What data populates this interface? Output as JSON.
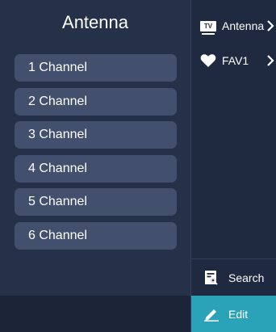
{
  "left_panel": {
    "title": "Antenna",
    "channels": [
      {
        "label": "1 Channel"
      },
      {
        "label": "2 Channel"
      },
      {
        "label": "3 Channel"
      },
      {
        "label": "4 Channel"
      },
      {
        "label": "5 Channel"
      },
      {
        "label": "6 Channel"
      }
    ]
  },
  "right_panel": {
    "nav": [
      {
        "label": "Antenna",
        "icon": "tv-icon"
      },
      {
        "label": "FAV1",
        "icon": "heart-icon"
      }
    ],
    "search_label": "Search",
    "edit_label": "Edit"
  },
  "colors": {
    "background": "#1f2a40",
    "channel_item": "#42506d",
    "edit_accent": "#2aa3b8"
  }
}
